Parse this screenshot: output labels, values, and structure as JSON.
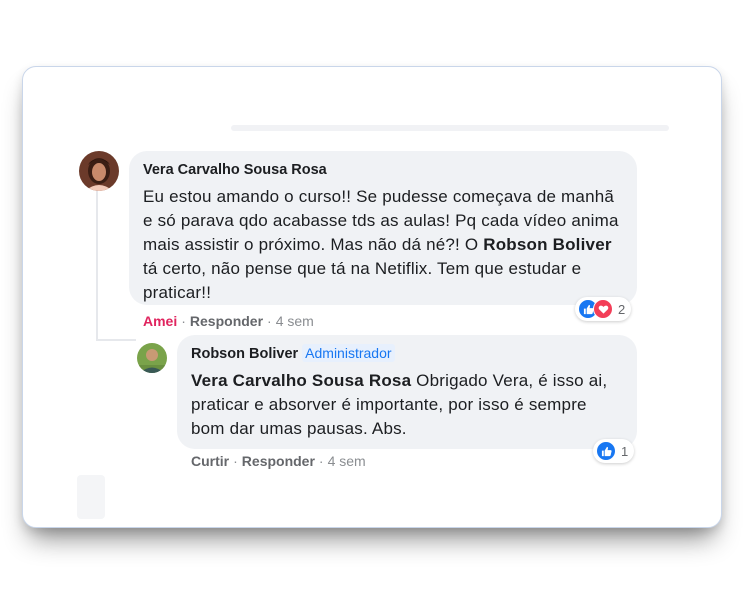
{
  "comments": [
    {
      "author": "Vera Carvalho Sousa Rosa",
      "text_part1": "Eu estou amando o curso!! Se pudesse começava de manhã e só parava qdo acabasse tds as aulas! Pq cada vídeo anima mais assistir o próximo. Mas não dá né?! O ",
      "mention": "Robson Boliver",
      "text_part2": " tá certo, não pense que tá na Netiflix. Tem que estudar e praticar!!",
      "reaction_label": "Amei",
      "reply_label": "Responder",
      "time": "4 sem",
      "reaction_count": "2",
      "reactions": [
        "like-icon",
        "love-icon"
      ],
      "avatar_icon": "user-avatar-photo"
    }
  ],
  "reply": {
    "author": "Robson Boliver",
    "badge": "Administrador",
    "mention": "Vera Carvalho Sousa Rosa",
    "text": " Obrigado Vera, é isso ai, praticar e absorver é importante, por isso é sempre bom dar umas pausas. Abs.",
    "like_label": "Curtir",
    "reply_label": "Responder",
    "time": "4 sem",
    "reaction_count": "1",
    "reactions": [
      "like-icon"
    ],
    "avatar_icon": "user-avatar-photo"
  },
  "colors": {
    "bubble": "#f0f2f5",
    "like": "#1877f2",
    "love": "#f33e58",
    "loved_text": "#e0245e",
    "badge": "#1877f2"
  }
}
